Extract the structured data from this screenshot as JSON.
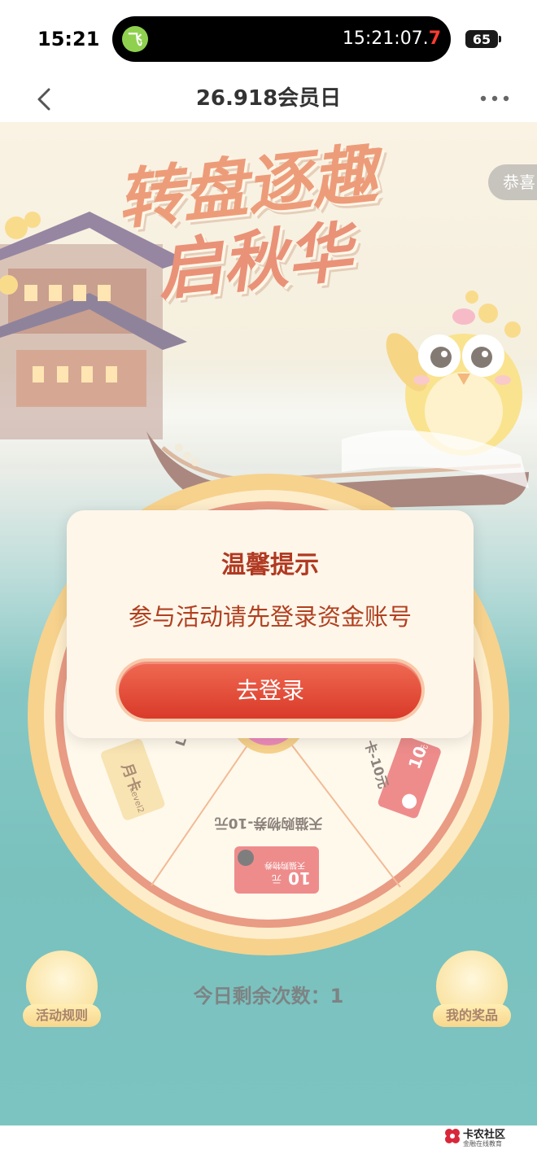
{
  "status_bar": {
    "time": "15:21",
    "island_app_glyph": "飞",
    "island_clock_main": "15:21:07.",
    "island_clock_tenth": "7",
    "battery": "65"
  },
  "nav": {
    "title": "26.918会员日",
    "back_icon": "chevron-left-icon",
    "more_icon": "more-dots-icon"
  },
  "banner": {
    "headline_line1": "转盘逐趣",
    "headline_line2": "启秋华",
    "congrats_tag": "恭喜"
  },
  "wheel": {
    "prizes": [
      {
        "label": "天猫购物券-10元",
        "coupon_value": "10",
        "coupon_unit": "元",
        "coupon_brand": "天猫购物券"
      },
      {
        "label": "Level2",
        "card_text": "月卡",
        "card_sub": "Level2"
      },
      {
        "label": "卡-10元",
        "coupon_value": "10",
        "coupon_unit": "元"
      }
    ]
  },
  "remaining": {
    "text": "今日剩余次数：",
    "count": "1"
  },
  "side_buttons": {
    "rules": "活动规则",
    "prizes": "我的奖品"
  },
  "dialog": {
    "title": "温馨提示",
    "message": "参与活动请先登录资金账号",
    "button": "去登录"
  },
  "watermark": {
    "name": "卡农社区",
    "sub": "金融在线教育"
  },
  "colors": {
    "accent_red": "#d93a2a",
    "dialog_bg": "#fff6ea",
    "title_red": "#b03a22",
    "teal": "#1e9995"
  }
}
